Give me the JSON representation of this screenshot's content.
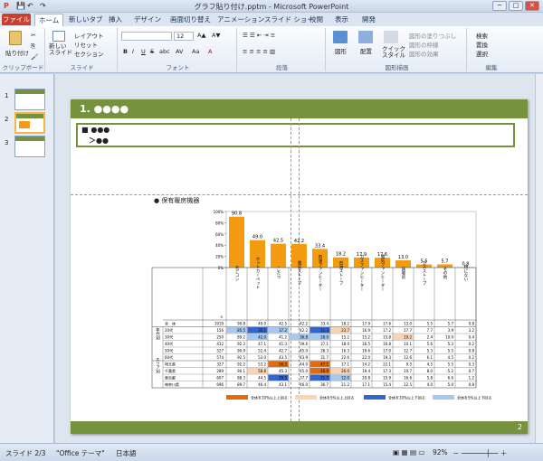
{
  "window": {
    "title": "グラフ貼り付け.pptm - Microsoft PowerPoint",
    "min": "─",
    "max": "□",
    "close": "✕"
  },
  "tabs": {
    "file": "ファイル",
    "items": [
      "ホーム",
      "新しいタブ",
      "挿入",
      "デザイン",
      "画面切り替え",
      "アニメーション",
      "スライド ショー",
      "校閲",
      "表示",
      "開発"
    ]
  },
  "ribbon": {
    "clipboard": {
      "label": "クリップボード",
      "paste": "貼り付け"
    },
    "slides": {
      "label": "スライド",
      "new_slide": "新しい\nスライド",
      "layout": "レイアウト",
      "reset": "リセット",
      "section": "セクション"
    },
    "font": {
      "label": "フォント",
      "size": "12",
      "bold": "B",
      "italic": "I",
      "underline": "U",
      "strike": "S",
      "shadow": "abc",
      "spacing": "AV",
      "case": "Aa",
      "color": "A"
    },
    "paragraph": {
      "label": "段落"
    },
    "drawing": {
      "label": "図形描画",
      "shapes": "図形",
      "arrange": "配置",
      "quick_styles": "クイック\nスタイル",
      "fill": "図形の塗りつぶし",
      "outline": "図形の枠線",
      "effects": "図形の効果"
    },
    "editing": {
      "label": "編集",
      "find": "検索",
      "replace": "置換",
      "select": "選択"
    }
  },
  "thumbs": [
    "1",
    "2",
    "3"
  ],
  "slide": {
    "header": "1. ●●●●",
    "bullet1": "■ ●●●",
    "bullet2": "＞●●",
    "chart_title": "● 保有暖房機器",
    "page": "2"
  },
  "status": {
    "slide": "スライド 2/3",
    "theme": "\"Office テーマ\"",
    "lang": "日本語",
    "zoom": "92%"
  },
  "chart_data": {
    "type": "bar",
    "categories": [
      "エアコン",
      "ホットカーペット",
      "こたつ",
      "電気ストーブ",
      "石油ファンヒーター",
      "石油ストーブ",
      "ガスファンヒーター",
      "電気ファンヒーター",
      "床暖房",
      "ガスストーブ",
      "その他",
      "特にない"
    ],
    "values": [
      90.8,
      49.0,
      42.5,
      42.2,
      33.4,
      18.2,
      17.9,
      17.6,
      13.0,
      5.5,
      5.7,
      0.8
    ],
    "ylim": [
      0,
      100
    ],
    "yticks": [
      "100%",
      "80%",
      "60%",
      "40%",
      "20%",
      "0%"
    ],
    "color": "#f39c12"
  },
  "table": {
    "n_label": "n",
    "group1": "年代別",
    "group2": "エリア別",
    "rows": [
      {
        "label": "全　体",
        "n": "1919",
        "v": [
          "90.8",
          "49.0",
          "42.5",
          "42.2",
          "33.4",
          "18.2",
          "17.9",
          "17.6",
          "13.0",
          "5.5",
          "5.7",
          "0.8"
        ]
      },
      {
        "label": "20代",
        "n": "156",
        "v": [
          "85.5",
          "35.1",
          "37.2",
          "42.2",
          "11.3",
          "23.7",
          "16.9",
          "17.2",
          "17.7",
          "7.7",
          "3.9",
          "3.2"
        ]
      },
      {
        "label": "30代",
        "n": "250",
        "v": [
          "89.2",
          "42.0",
          "41.2",
          "36.8",
          "28.0",
          "15.2",
          "15.2",
          "15.8",
          "19.2",
          "2.4",
          "10.0",
          "0.4"
        ]
      },
      {
        "label": "40代",
        "n": "412",
        "v": [
          "92.2",
          "47.1",
          "41.3",
          "39.6",
          "37.1",
          "18.0",
          "16.5",
          "16.8",
          "14.1",
          "5.6",
          "5.3",
          "0.2"
        ]
      },
      {
        "label": "50代",
        "n": "527",
        "v": [
          "90.9",
          "52.4",
          "42.7",
          "45.0",
          "38.3",
          "16.3",
          "18.6",
          "17.0",
          "12.7",
          "5.3",
          "5.5",
          "0.8"
        ]
      },
      {
        "label": "60代",
        "n": "574",
        "v": [
          "92.5",
          "53.0",
          "43.5",
          "43.9",
          "31.7",
          "22.6",
          "22.0",
          "19.3",
          "12.6",
          "6.1",
          "4.5",
          "0.2"
        ]
      },
      {
        "label": "埼玉県",
        "n": "327",
        "v": [
          "92.2",
          "53.2",
          "56.3",
          "44.0",
          "47.1",
          "17.1",
          "14.2",
          "22.1",
          "9.5",
          "4.5",
          "5.5",
          "0.3"
        ]
      },
      {
        "label": "千葉県",
        "n": "289",
        "v": [
          "90.1",
          "58.8",
          "45.3",
          "45.0",
          "46.9",
          "26.0",
          "19.4",
          "17.3",
          "10.7",
          "8.0",
          "5.2",
          "0.7"
        ]
      },
      {
        "label": "東京都",
        "n": "607",
        "v": [
          "88.3",
          "44.5",
          "29.5",
          "37.7",
          "21.7",
          "12.0",
          "20.8",
          "15.9",
          "16.6",
          "5.8",
          "6.6",
          "1.2"
        ]
      },
      {
        "label": "神奈川県",
        "n": "696",
        "v": [
          "89.7",
          "46.4",
          "43.1",
          "46.0",
          "36.7",
          "21.2",
          "17.1",
          "15.4",
          "12.5",
          "4.0",
          "5.0",
          "0.8"
        ]
      }
    ],
    "legend": [
      "全体を10%以上上回る",
      "全体を5%以上上回る",
      "全体を10%以上下回る",
      "全体を5%以上下回る"
    ]
  }
}
